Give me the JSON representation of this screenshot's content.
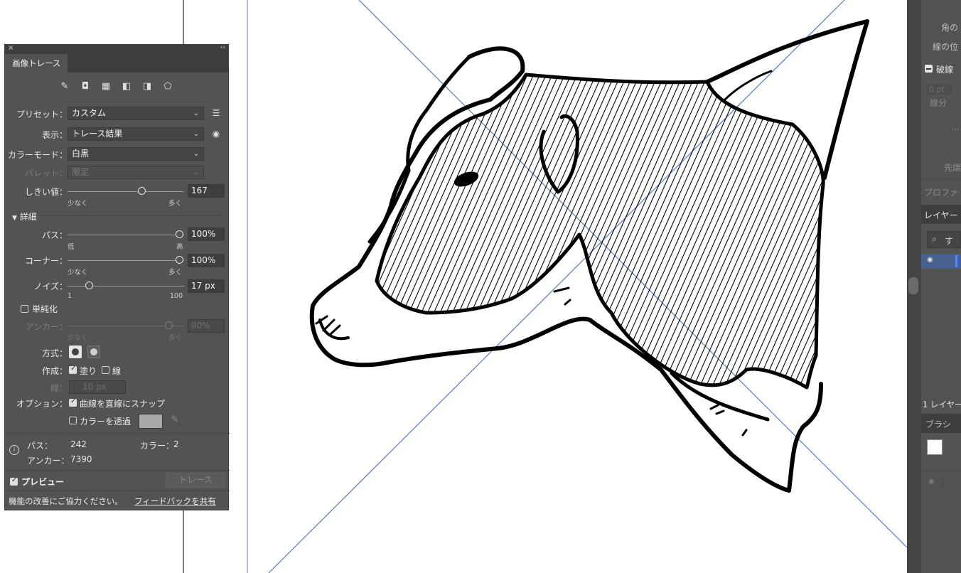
{
  "panel": {
    "tab_title": "画像トレース",
    "close_glyph": "×",
    "collapse_glyph": "‹‹",
    "preset": {
      "label": "プリセット：",
      "value": "カスタム"
    },
    "view": {
      "label": "表示：",
      "value": "トレース結果"
    },
    "color_mode": {
      "label": "カラーモード：",
      "value": "白黒"
    },
    "palette": {
      "label": "パレット：",
      "value": "限定"
    },
    "threshold": {
      "label": "しきい値：",
      "value": "167",
      "min_label": "少なく",
      "max_label": "多く",
      "level": 0.67
    },
    "advanced": {
      "label": "詳細"
    },
    "paths": {
      "label": "パス：",
      "value": "100%",
      "min_label": "低",
      "max_label": "高",
      "level": 1.0
    },
    "corners": {
      "label": "コーナー：",
      "value": "100%",
      "min_label": "少なく",
      "max_label": "多く",
      "level": 1.0
    },
    "noise": {
      "label": "ノイズ：",
      "value": "17 px",
      "min_label": "1",
      "max_label": "100",
      "level": 0.16
    },
    "simplify": {
      "label": "単純化",
      "checked": false
    },
    "anchor": {
      "label": "アンカー：",
      "value": "90%",
      "min_label": "少なく",
      "max_label": "多く",
      "level": 0.9
    },
    "method": {
      "label": "方式："
    },
    "create": {
      "label": "作成：",
      "fills": "塗り",
      "fills_checked": true,
      "strokes": "線",
      "strokes_checked": false
    },
    "stroke": {
      "label": "線：",
      "value": "10 px"
    },
    "options": {
      "label": "オプション：",
      "snap": "曲線を直線にスナップ",
      "snap_checked": true,
      "ignore_color": "カラーを透過",
      "ignore_checked": false
    },
    "stats": {
      "paths_label": "パス：",
      "paths_value": "242",
      "colors_label": "カラー：",
      "colors_value": "2",
      "anchors_label": "アンカー：",
      "anchors_value": "7390"
    },
    "preview": {
      "label": "プレビュー",
      "checked": true
    },
    "trace_button": "トレース",
    "footer": {
      "text": "機能の改善にご協力ください。",
      "link": "フィードバックを共有"
    }
  },
  "right_dock": {
    "corner_label": "角の",
    "stroke_label": "線の位",
    "dashed_label": "破線",
    "dash_value": "0 pt",
    "dash_sub": "線分",
    "cap_label": "先端位",
    "profile_label": "プロファ",
    "layers_tab": "レイヤー",
    "search_placeholder": "す",
    "layers_count": "1 レイヤー",
    "brush_tab": "ブラシ"
  },
  "colors": {
    "panel_bg": "#535353",
    "field_bg": "#454545",
    "guide_blue": "#5b79c4",
    "ink": "#000000"
  }
}
